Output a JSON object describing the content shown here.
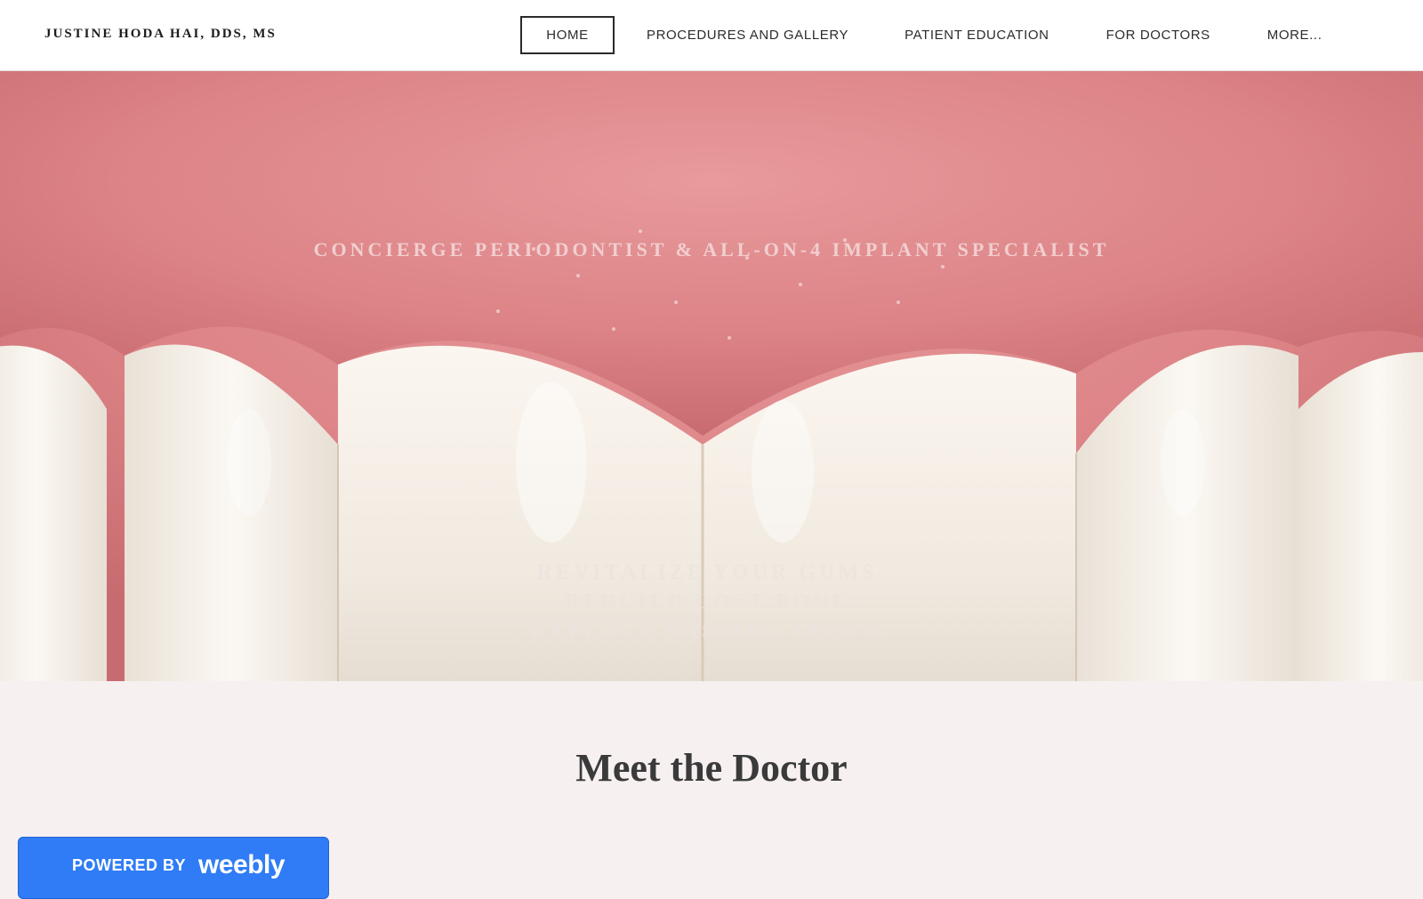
{
  "header": {
    "site_title": "JUSTINE HODA HAI, DDS, MS",
    "nav": [
      {
        "label": "HOME",
        "active": true
      },
      {
        "label": "PROCEDURES AND GALLERY"
      },
      {
        "label": "PATIENT EDUCATION"
      },
      {
        "label": "FOR DOCTORS"
      },
      {
        "label": "MORE..."
      }
    ]
  },
  "hero": {
    "tagline": "CONCIERGE PERIODONTIST & ALL-ON-4 IMPLANT SPECIALIST",
    "lines": [
      "REVITALIZE YOUR GUMS.",
      "REBUILD LOST BONE.",
      "REPLACE MISSING TEETH."
    ],
    "image": "teeth-and-gums-photo"
  },
  "main": {
    "section_title": "Meet the Doctor"
  },
  "badge": {
    "powered_by": "POWERED BY",
    "brand": "weebly"
  },
  "colors": {
    "header_bg": "#ffffff",
    "page_bg": "#f6f0f0",
    "badge_bg": "#2f7cf6",
    "gum": "#d97f82",
    "tooth": "#f4efe8"
  }
}
